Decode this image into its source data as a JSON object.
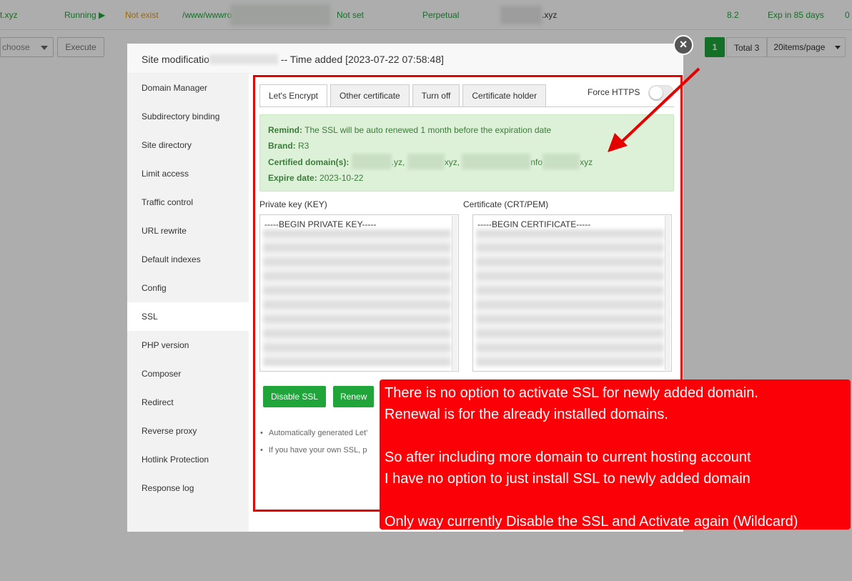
{
  "background": {
    "row": {
      "name": "t.xyz",
      "status": "Running",
      "backup": "Not exist",
      "path": "/www/wwwro",
      "expiry_note": "Not set",
      "period": "Perpetual",
      "domain_tail": ".xyz",
      "php": "8.2",
      "ssl": "Exp in 85 days",
      "edge": "0"
    },
    "batch_select": "choose",
    "execute_label": "Execute",
    "pager": {
      "current": "1",
      "total": "Total 3",
      "per_page": "20items/page"
    }
  },
  "modal": {
    "title_prefix": "Site modificatio",
    "title_suffix": "-- Time added [2023-07-22 07:58:48]",
    "close_symbol": "×",
    "sidebar": [
      "Domain Manager",
      "Subdirectory binding",
      "Site directory",
      "Limit access",
      "Traffic control",
      "URL rewrite",
      "Default indexes",
      "Config",
      "SSL",
      "PHP version",
      "Composer",
      "Redirect",
      "Reverse proxy",
      "Hotlink Protection",
      "Response log"
    ],
    "active_item": "SSL",
    "tabs": [
      "Let's Encrypt",
      "Other certificate",
      "Turn off",
      "Certificate holder"
    ],
    "force_https": "Force HTTPS",
    "force_https_enabled": false,
    "remind": {
      "remind_label": "Remind:",
      "remind_text": " The SSL will be auto renewed 1 month before the expiration date",
      "brand_label": "Brand:",
      "brand": " R3",
      "domains_label": "Certified domain(s):",
      "domains_parts": [
        ".yz, ",
        "xyz, ",
        "nfo",
        "xyz"
      ],
      "expire_label": "Expire date:",
      "expire": " 2023-10-22"
    },
    "key_label": "Private key (KEY)",
    "key_first_line": "-----BEGIN PRIVATE KEY-----",
    "cert_label": "Certificate (CRT/PEM)",
    "cert_first_line": "-----BEGIN CERTIFICATE-----",
    "disable_ssl": "Disable SSL",
    "renew": "Renew",
    "tips": [
      "Automatically generated Let'",
      "If you have your own SSL, p"
    ]
  },
  "callout": {
    "lines": [
      "There is no option to activate SSL for newly added domain.",
      "Renewal is for the already installed domains.",
      "",
      "So after including more domain to current hosting account",
      "I have no option to just install SSL to newly added domain",
      "",
      "Only way currently Disable the SSL and Activate again (Wildcard)"
    ]
  },
  "colors": {
    "accent_green": "#20a53a",
    "annotation_red": "#fb0007",
    "remind_bg": "#ddf1d8"
  }
}
